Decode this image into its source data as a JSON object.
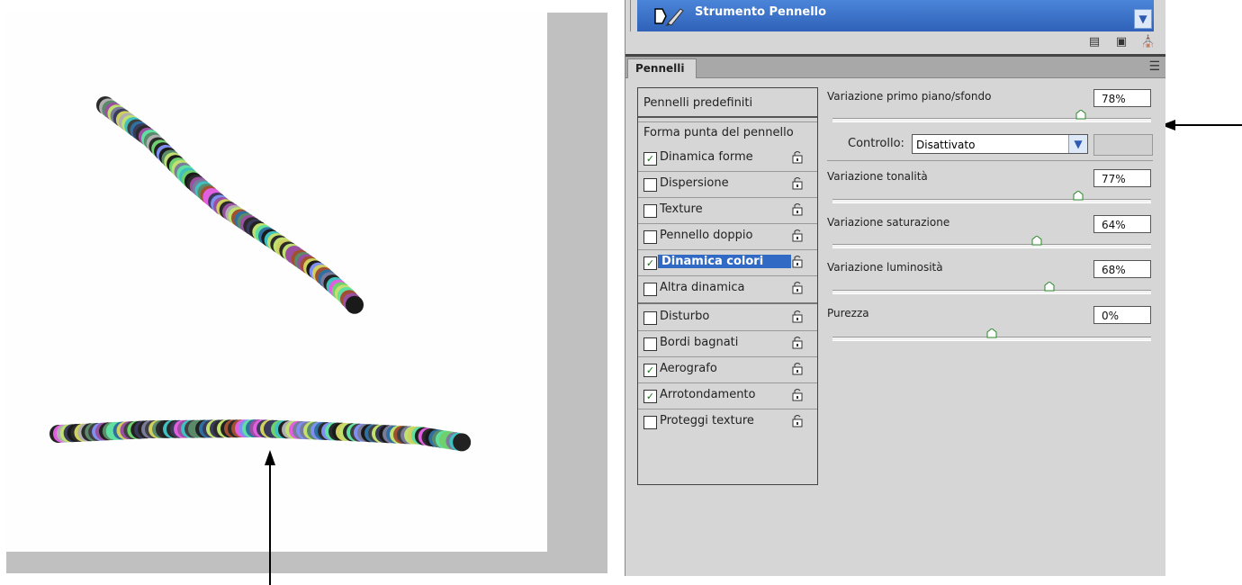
{
  "tool": {
    "name": "Strumento Pennello",
    "icon": "brush-tool-icon"
  },
  "panel": {
    "tab_label": "Pennelli"
  },
  "brush_list": {
    "preset_header": "Pennelli predefiniti",
    "shape_header": "Forma punta del pennello",
    "options": [
      {
        "label": "Dinamica forme",
        "checked": true,
        "selected": false
      },
      {
        "label": "Dispersione",
        "checked": false,
        "selected": false
      },
      {
        "label": "Texture",
        "checked": false,
        "selected": false
      },
      {
        "label": "Pennello doppio",
        "checked": false,
        "selected": false
      },
      {
        "label": "Dinamica colori",
        "checked": true,
        "selected": true
      },
      {
        "label": "Altra dinamica",
        "checked": false,
        "selected": false
      },
      {
        "label": "Disturbo",
        "checked": false,
        "selected": false
      },
      {
        "label": "Bordi bagnati",
        "checked": false,
        "selected": false
      },
      {
        "label": "Aerografo",
        "checked": true,
        "selected": false
      },
      {
        "label": "Arrotondamento",
        "checked": true,
        "selected": false
      },
      {
        "label": "Proteggi texture",
        "checked": false,
        "selected": false
      }
    ]
  },
  "settings": {
    "fg_bg": {
      "label": "Variazione primo piano/sfondo",
      "value": "78%",
      "level": 0.78
    },
    "control": {
      "label": "Controllo:",
      "value": "Disattivato"
    },
    "hue": {
      "label": "Variazione tonalità",
      "value": "77%",
      "level": 0.77
    },
    "saturation": {
      "label": "Variazione saturazione",
      "value": "64%",
      "level": 0.64
    },
    "brightness": {
      "label": "Variazione luminosità",
      "value": "68%",
      "level": 0.68
    },
    "purity": {
      "label": "Purezza",
      "value": "0%",
      "level": 0.5
    }
  },
  "colors": {
    "selection": "#316ac5",
    "title_bar": "#2f62b8"
  }
}
